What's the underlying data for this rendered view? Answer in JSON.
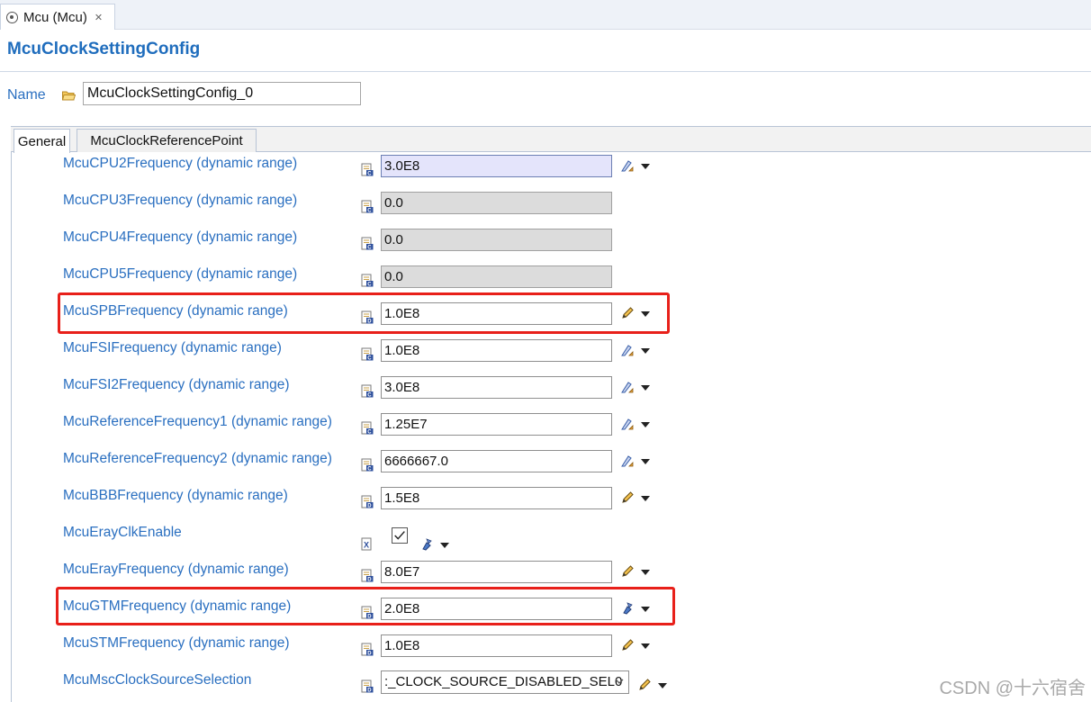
{
  "editor_tab": {
    "title": "Mcu (Mcu)",
    "close": "✕"
  },
  "page_title": "McuClockSettingConfig",
  "name_field": {
    "label": "Name",
    "value": "McuClockSettingConfig_0"
  },
  "subtabs": [
    "General",
    "McuClockReferencePoint"
  ],
  "rows": [
    {
      "label": "McuCPU2Frequency (dynamic range)",
      "value": "3.0E8",
      "state": "focused",
      "action": "calc"
    },
    {
      "label": "McuCPU3Frequency (dynamic range)",
      "value": "0.0",
      "state": "disabled",
      "action": ""
    },
    {
      "label": "McuCPU4Frequency (dynamic range)",
      "value": "0.0",
      "state": "disabled",
      "action": ""
    },
    {
      "label": "McuCPU5Frequency (dynamic range)",
      "value": "0.0",
      "state": "disabled",
      "action": ""
    },
    {
      "label": "McuSPBFrequency (dynamic range)",
      "value": "1.0E8",
      "state": "normal",
      "action": "edit"
    },
    {
      "label": "McuFSIFrequency (dynamic range)",
      "value": "1.0E8",
      "state": "normal",
      "action": "calc"
    },
    {
      "label": "McuFSI2Frequency (dynamic range)",
      "value": "3.0E8",
      "state": "normal",
      "action": "calc"
    },
    {
      "label": "McuReferenceFrequency1 (dynamic range)",
      "value": "1.25E7",
      "state": "normal",
      "action": "calc"
    },
    {
      "label": "McuReferenceFrequency2 (dynamic range)",
      "value": "6666667.0",
      "state": "normal",
      "action": "calc"
    },
    {
      "label": "McuBBBFrequency (dynamic range)",
      "value": "1.5E8",
      "state": "normal",
      "action": "edit"
    },
    {
      "label": "McuErayClkEnable",
      "value": "",
      "state": "checkbox",
      "action": "default"
    },
    {
      "label": "McuErayFrequency (dynamic range)",
      "value": "8.0E7",
      "state": "normal",
      "action": "edit"
    },
    {
      "label": "McuGTMFrequency (dynamic range)",
      "value": "2.0E8",
      "state": "normal",
      "action": "default"
    },
    {
      "label": "McuSTMFrequency (dynamic range)",
      "value": "1.0E8",
      "state": "normal",
      "action": "edit"
    },
    {
      "label": "McuMscClockSourceSelection",
      "value": ":_CLOCK_SOURCE_DISABLED_SEL0",
      "state": "combo",
      "action": "edit"
    }
  ],
  "checkbox_checked": true,
  "highlighted_rows": [
    "McuSPBFrequency (dynamic range)",
    "McuGTMFrequency (dynamic range)"
  ],
  "watermark": "CSDN @十六宿舍",
  "colors": {
    "label_blue": "#2a6fc0",
    "title_blue": "#1f6dbd",
    "highlight_red": "#e8201a",
    "focused_field": "#e4e4fb",
    "disabled_field": "#dcdcdc"
  },
  "icons": {
    "calc": "calculator-wand-icon",
    "edit": "pencil-icon",
    "default": "restore-default-icon",
    "config": "config-doc-icon"
  }
}
